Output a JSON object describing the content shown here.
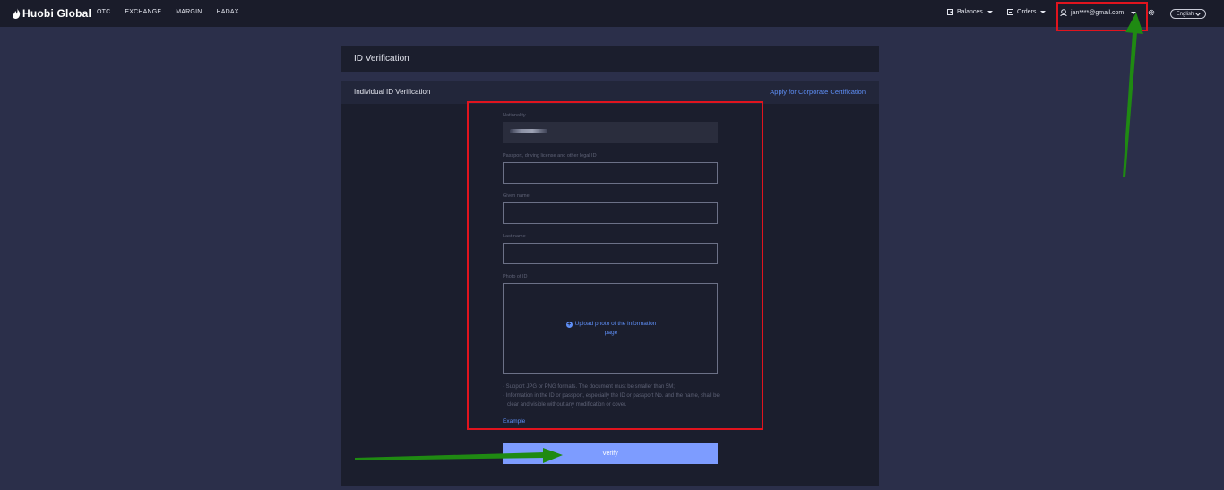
{
  "header": {
    "logo": "Huobi Global",
    "nav": [
      "OTC",
      "EXCHANGE",
      "MARGIN",
      "HADAX"
    ],
    "balances": "Balances",
    "orders": "Orders",
    "account": "jan****@gmail.com",
    "language": "English"
  },
  "page": {
    "title": "ID Verification",
    "section_title": "Individual ID Verification",
    "corporate_link": "Apply for Corporate Certification"
  },
  "form": {
    "nationality_label": "Nationality",
    "id_label": "Passport, driving license and other legal ID",
    "given_name_label": "Given name",
    "last_name_label": "Last name",
    "photo_label": "Photo of ID",
    "upload_line1": "Upload photo of the information",
    "upload_line2": "page",
    "note1": "· Support JPG or PNG formats. The document must be smaller than 5M;",
    "note2": "· Information in the ID or passport, especially the ID or passport No. and the name, shall be clear and visible without any modification or cover.",
    "example": "Example",
    "verify": "Verify"
  },
  "colors": {
    "background": "#2b2f4a",
    "topbar": "#1a1c2a",
    "panel": "#1b1e2d",
    "link": "#5e8ef5",
    "button": "#7d9cff",
    "annotation_red": "#e0141e",
    "annotation_green": "#1f8a12"
  },
  "icons": {
    "logo": "flame-icon",
    "balances": "wallet-icon",
    "orders": "orders-icon",
    "account": "user-icon",
    "settings": "gear-icon",
    "upload": "plus-circle-icon"
  }
}
